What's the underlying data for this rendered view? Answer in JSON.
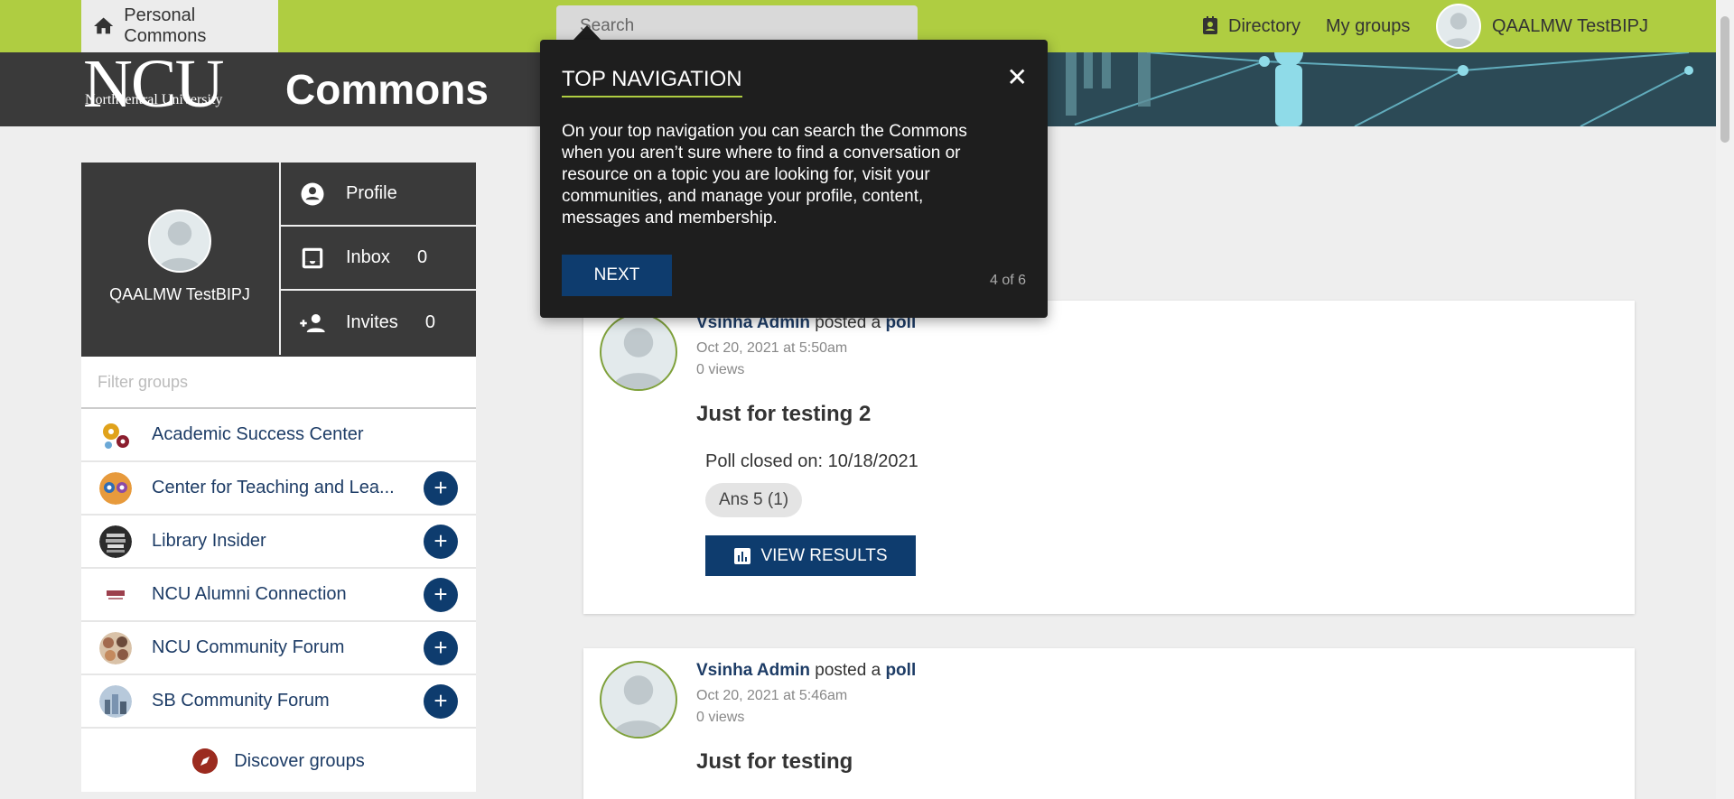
{
  "topnav": {
    "home_label": "Personal Commons",
    "search_placeholder": "Search",
    "directory_label": "Directory",
    "mygroups_label": "My groups",
    "user_name": "QAALMW TestBIPJ"
  },
  "banner": {
    "logo_big": "NCU",
    "logo_small": "Northcentral University",
    "title": "Commons"
  },
  "profile": {
    "name": "QAALMW TestBIPJ",
    "menu": [
      {
        "label": "Profile",
        "count": ""
      },
      {
        "label": "Inbox",
        "count": "0"
      },
      {
        "label": "Invites",
        "count": "0"
      }
    ]
  },
  "groups": {
    "filter_placeholder": "Filter groups",
    "items": [
      {
        "label": "Academic Success Center",
        "joinable": false,
        "color": "#e0a21b"
      },
      {
        "label": "Center for Teaching and Lea...",
        "joinable": true,
        "color": "#e79a3c"
      },
      {
        "label": "Library Insider",
        "joinable": true,
        "color": "#2b2b2b"
      },
      {
        "label": "NCU Alumni Connection",
        "joinable": true,
        "color": "#ffffff"
      },
      {
        "label": "NCU Community Forum",
        "joinable": true,
        "color": "#a26a4e"
      },
      {
        "label": "SB Community Forum",
        "joinable": true,
        "color": "#7a93b0"
      }
    ],
    "add_symbol": "+",
    "discover_label": "Discover groups"
  },
  "posts": [
    {
      "author": "Vsinha Admin",
      "verb": "posted a",
      "type": "poll",
      "date": "Oct 20, 2021 at 5:50am",
      "views": "0 views",
      "title": "Just for testing 2",
      "poll_closed": "Poll closed on: 10/18/2021",
      "answer": "Ans 5 (1)",
      "button": "VIEW RESULTS"
    },
    {
      "author": "Vsinha Admin",
      "verb": "posted a",
      "type": "poll",
      "date": "Oct 20, 2021 at 5:46am",
      "views": "0 views",
      "title": "Just for testing"
    }
  ],
  "tour": {
    "title": "TOP NAVIGATION",
    "close": "✕",
    "body": "On your top navigation you can search the Commons when you aren’t sure where to find a conversation or resource on a topic you are looking for, visit your communities, and manage your profile, content, messages and membership.",
    "next": "NEXT",
    "step": "4 of 6"
  },
  "colors": {
    "topbar": "#afcd41",
    "banner": "#3a3a3a",
    "primary_button": "#0e3c6e",
    "link": "#1d3c66"
  }
}
